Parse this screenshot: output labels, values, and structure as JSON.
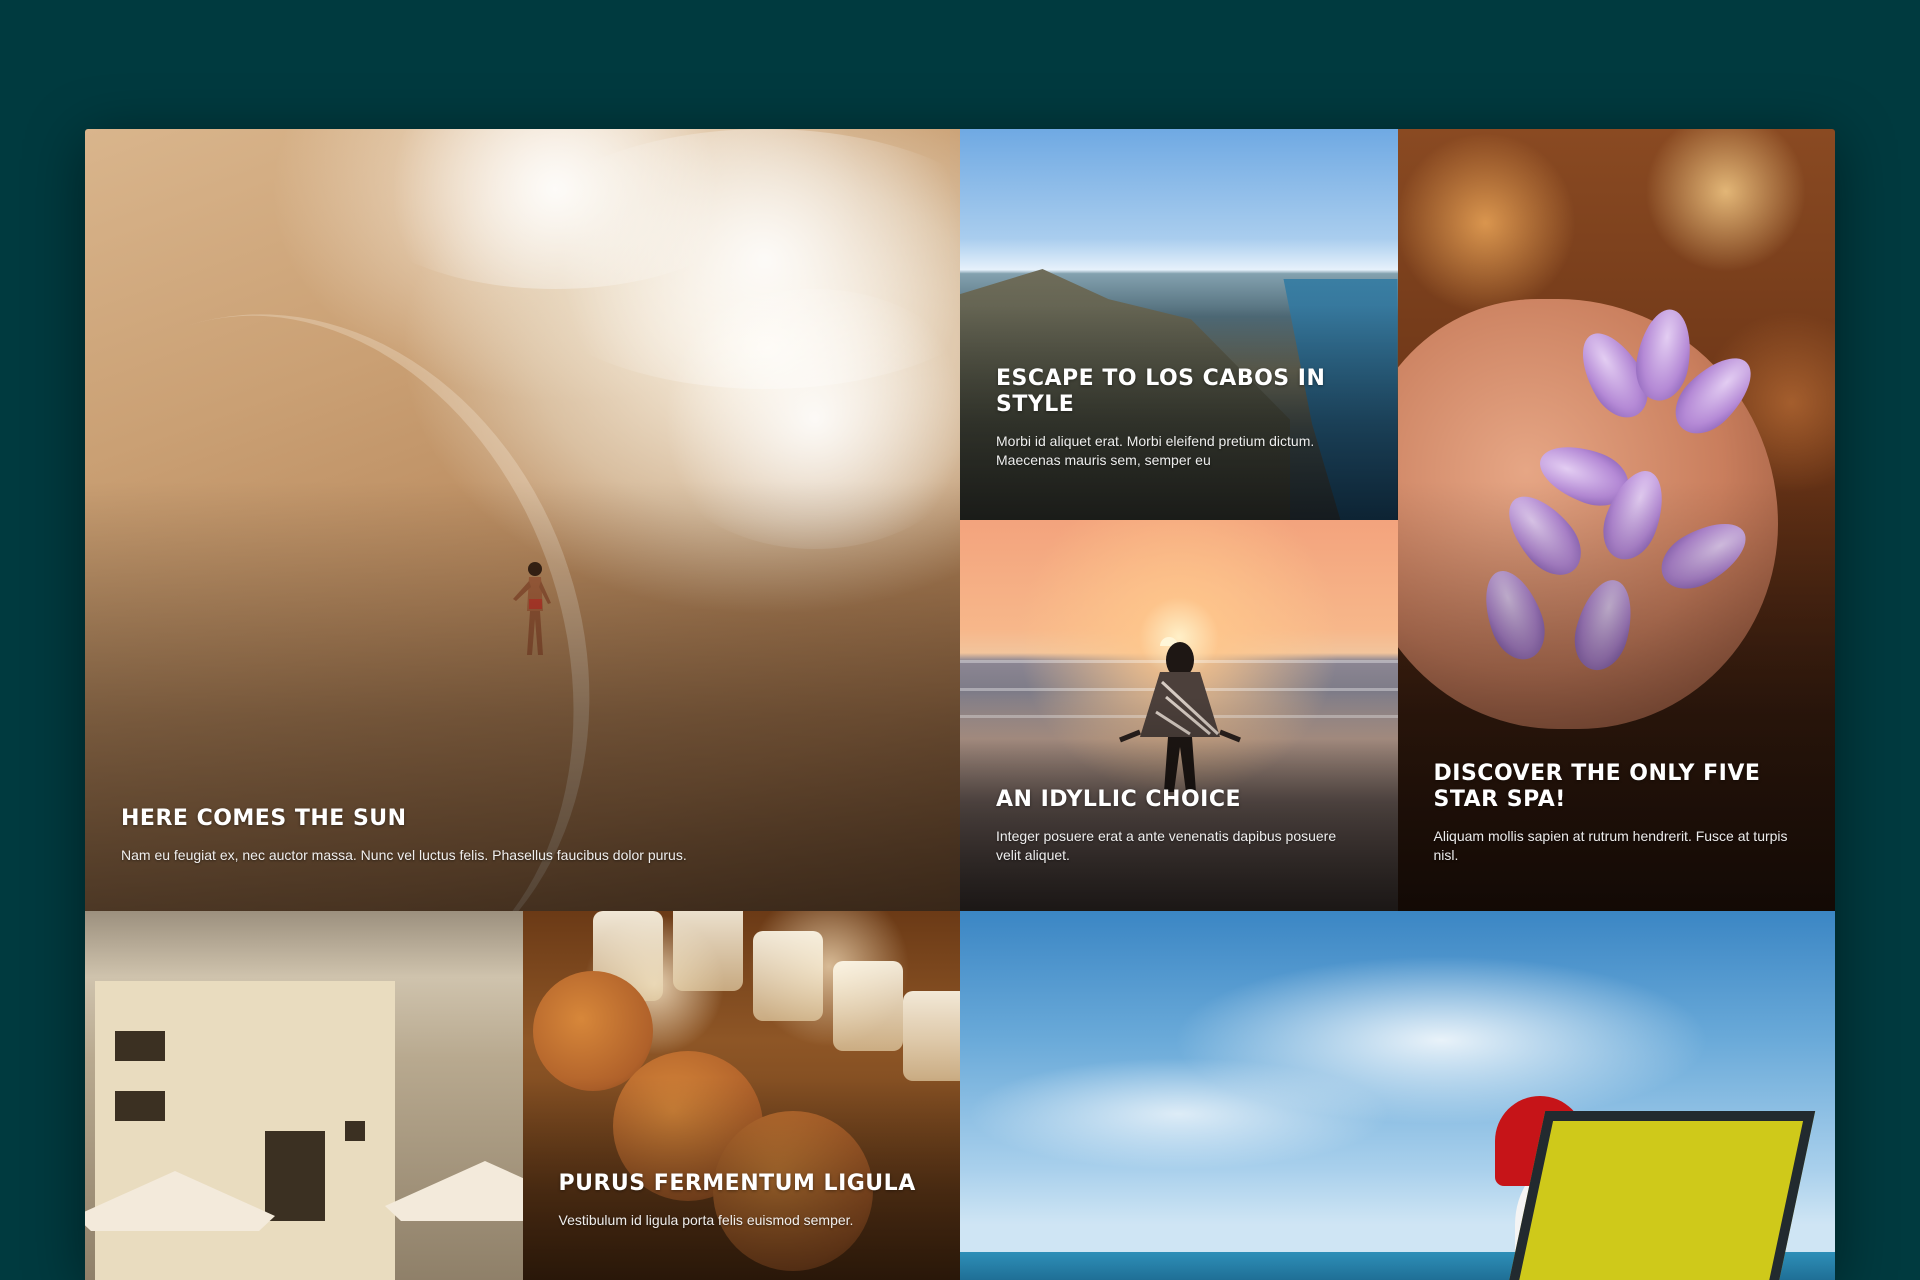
{
  "tiles": [
    {
      "title": "HERE COMES THE SUN",
      "text": "Nam eu feugiat ex, nec auctor massa. Nunc vel luctus felis. Phasellus faucibus dolor purus."
    },
    {
      "title": "ESCAPE TO LOS CABOS IN STYLE",
      "text": "Morbi id aliquet erat. Morbi eleifend pretium dictum. Maecenas mauris sem, semper eu"
    },
    {
      "title": "AN IDYLLIC CHOICE",
      "text": "Integer posuere erat a ante venenatis dapibus posuere velit aliquet."
    },
    {
      "title": "DISCOVER THE ONLY FIVE STAR SPA!",
      "text": "Aliquam mollis sapien at rutrum hendrerit. Fusce at turpis nisl."
    },
    {
      "title": "",
      "text": ""
    },
    {
      "title": "PURUS FERMENTUM LIGULA",
      "text": "Vestibulum id ligula porta felis euismod semper."
    },
    {
      "title": "",
      "text": ""
    }
  ],
  "colors": {
    "page_background": "#003a3f"
  }
}
